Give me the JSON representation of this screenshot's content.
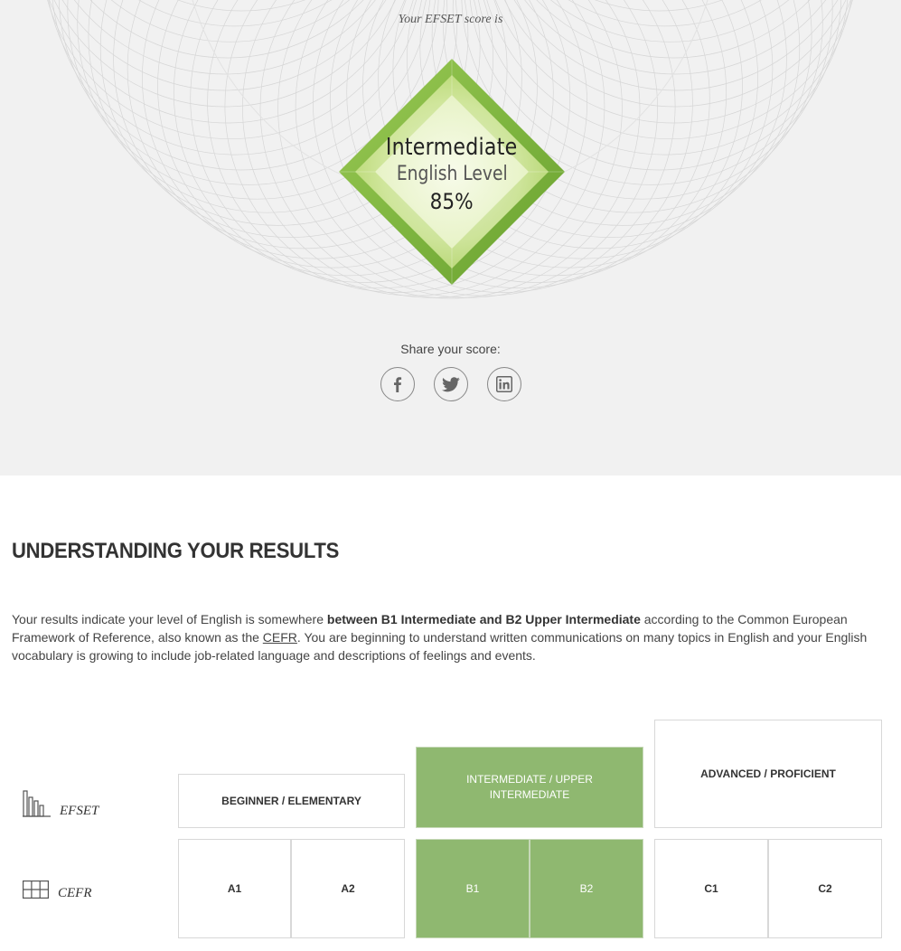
{
  "hero": {
    "score_label": "Your EFSET score is",
    "badge": {
      "level": "Intermediate",
      "subtitle": "English Level",
      "score": "85%",
      "colors": {
        "outer": "#7fb640",
        "inner": "#d7ea9c",
        "center": "#eef6d2"
      }
    },
    "share": {
      "label": "Share your score:",
      "buttons": [
        {
          "name": "facebook",
          "icon": "facebook-icon"
        },
        {
          "name": "twitter",
          "icon": "twitter-icon"
        },
        {
          "name": "linkedin",
          "icon": "linkedin-icon"
        }
      ]
    }
  },
  "results": {
    "title": "UNDERSTANDING YOUR RESULTS",
    "desc_part1": "Your results indicate your level of English is somewhere ",
    "desc_bold": "between B1 Intermediate and B2 Upper Intermediate",
    "desc_part2": " according to the Common European Framework of Reference, also known as the ",
    "desc_link": "CEFR",
    "desc_part3": ". You are beginning to understand written communications on many topics in English and your English vocabulary is growing to include job-related language and descriptions of feelings and events."
  },
  "scale": {
    "efset_label": "EFSET",
    "cefr_label": "CEFR",
    "bands": [
      {
        "label": "BEGINNER / ELEMENTARY",
        "active": false
      },
      {
        "label": "INTERMEDIATE / UPPER INTERMEDIATE",
        "active": true
      },
      {
        "label": "ADVANCED / PROFICIENT",
        "active": false
      }
    ],
    "levels": [
      {
        "label": "A1",
        "active": false
      },
      {
        "label": "A2",
        "active": false
      },
      {
        "label": "B1",
        "active": true
      },
      {
        "label": "B2",
        "active": true
      },
      {
        "label": "C1",
        "active": false
      },
      {
        "label": "C2",
        "active": false
      }
    ],
    "active_color": "#8fb870"
  }
}
